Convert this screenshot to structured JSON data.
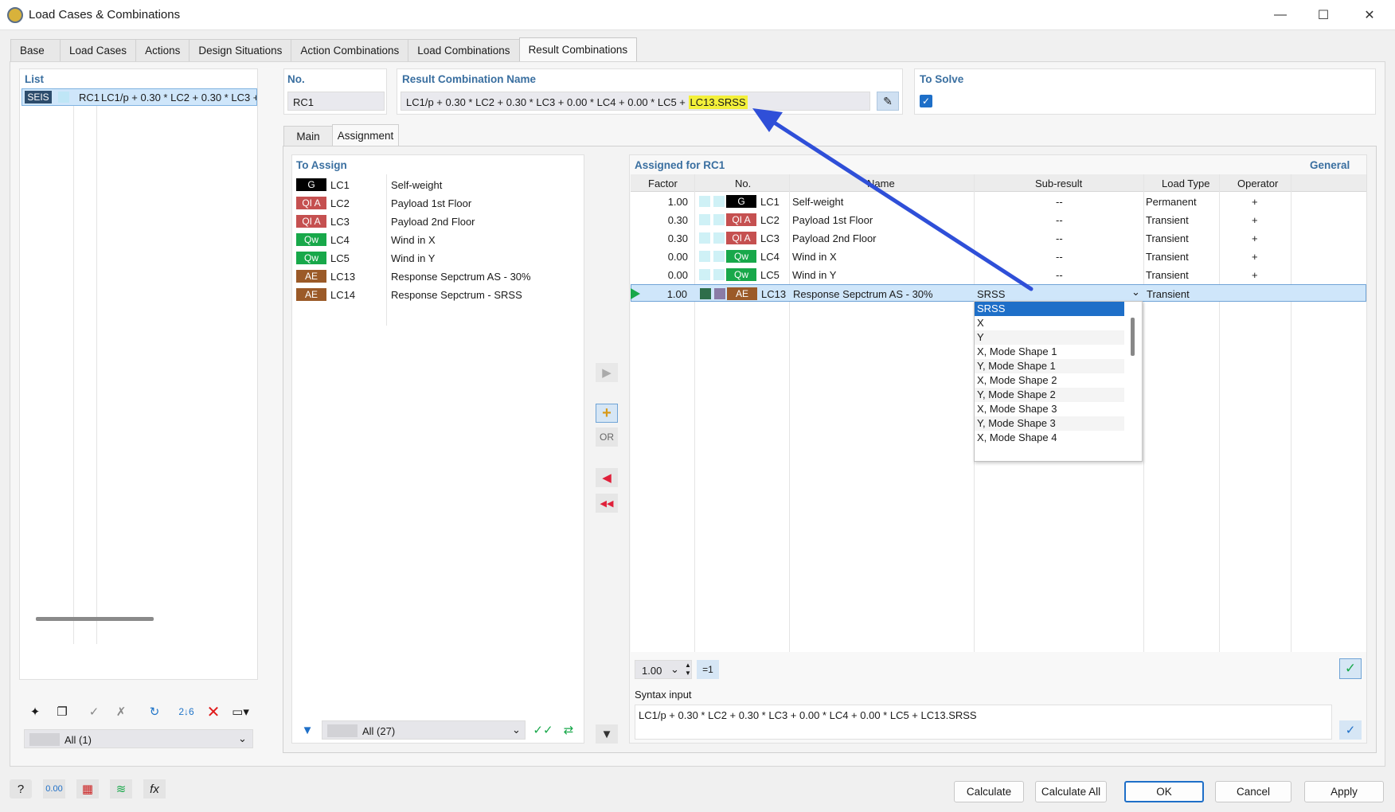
{
  "window": {
    "title": "Load Cases & Combinations"
  },
  "tabs": [
    "Base",
    "Load Cases",
    "Actions",
    "Design Situations",
    "Action Combinations",
    "Load Combinations",
    "Result Combinations"
  ],
  "list": {
    "header": "List",
    "item": {
      "badge": "SEIS",
      "no": "RC1",
      "text": "LC1/p + 0.30 * LC2 + 0.30 * LC3 + "
    },
    "filter_value": "All (1)"
  },
  "no_panel": {
    "header": "No.",
    "value": "RC1"
  },
  "name_panel": {
    "header": "Result Combination Name",
    "value_main": "LC1/p + 0.30 * LC2 + 0.30 * LC3 + 0.00 * LC4 + 0.00 * LC5 + ",
    "value_highlight": "LC13.SRSS"
  },
  "solve_panel": {
    "header": "To Solve",
    "checked": true
  },
  "subtabs": [
    "Main",
    "Assignment"
  ],
  "to_assign": {
    "header": "To Assign",
    "rows": [
      {
        "badge": "G",
        "kind": "g",
        "no": "LC1",
        "name": "Self-weight"
      },
      {
        "badge": "QI A",
        "kind": "qi",
        "no": "LC2",
        "name": "Payload 1st Floor"
      },
      {
        "badge": "QI A",
        "kind": "qi",
        "no": "LC3",
        "name": "Payload 2nd Floor"
      },
      {
        "badge": "Qw",
        "kind": "qw",
        "no": "LC4",
        "name": "Wind in X"
      },
      {
        "badge": "Qw",
        "kind": "qw",
        "no": "LC5",
        "name": "Wind in Y"
      },
      {
        "badge": "AE",
        "kind": "ae",
        "no": "LC13",
        "name": "Response Sepctrum AS - 30%"
      },
      {
        "badge": "AE",
        "kind": "ae",
        "no": "LC14",
        "name": "Response Sepctrum - SRSS"
      }
    ],
    "filter_value": "All (27)"
  },
  "middle": {
    "or_label": "OR"
  },
  "assigned": {
    "header": "Assigned for RC1",
    "general": "General",
    "columns": [
      "Factor",
      "No.",
      "Name",
      "Sub-result",
      "Load Type",
      "Operator"
    ],
    "rows": [
      {
        "factor": "1.00",
        "badge": "G",
        "kind": "g",
        "no": "LC1",
        "name": "Self-weight",
        "sub": "--",
        "type": "Permanent",
        "op": "+"
      },
      {
        "factor": "0.30",
        "badge": "QI A",
        "kind": "qi",
        "no": "LC2",
        "name": "Payload 1st Floor",
        "sub": "--",
        "type": "Transient",
        "op": "+"
      },
      {
        "factor": "0.30",
        "badge": "QI A",
        "kind": "qi",
        "no": "LC3",
        "name": "Payload 2nd Floor",
        "sub": "--",
        "type": "Transient",
        "op": "+"
      },
      {
        "factor": "0.00",
        "badge": "Qw",
        "kind": "qw",
        "no": "LC4",
        "name": "Wind in X",
        "sub": "--",
        "type": "Transient",
        "op": "+"
      },
      {
        "factor": "0.00",
        "badge": "Qw",
        "kind": "qw",
        "no": "LC5",
        "name": "Wind in Y",
        "sub": "--",
        "type": "Transient",
        "op": "+"
      },
      {
        "factor": "1.00",
        "badge": "AE",
        "kind": "ae",
        "no": "LC13",
        "name": "Response Sepctrum AS - 30%",
        "sub": "SRSS",
        "type": "Transient",
        "op": ""
      }
    ],
    "dropdown": [
      "SRSS",
      "X",
      "Y",
      "X, Mode Shape 1",
      "Y, Mode Shape 1",
      "X, Mode Shape 2",
      "Y, Mode Shape 2",
      "X, Mode Shape 3",
      "Y, Mode Shape 3",
      "X, Mode Shape 4"
    ],
    "factor_value": "1.00",
    "eq_label": "=1",
    "syntax_label": "Syntax input",
    "syntax_value": "LC1/p + 0.30 * LC2 + 0.30 * LC3 + 0.00 * LC4 + 0.00 * LC5 + LC13.SRSS"
  },
  "footer": {
    "calculate": "Calculate",
    "calculate_all": "Calculate All",
    "ok": "OK",
    "cancel": "Cancel",
    "apply": "Apply"
  },
  "colors": {
    "accent": "#3a6fa0",
    "highlight": "#f3f03a",
    "selection": "#cfe6fa",
    "arrow": "#2f4fd8"
  }
}
